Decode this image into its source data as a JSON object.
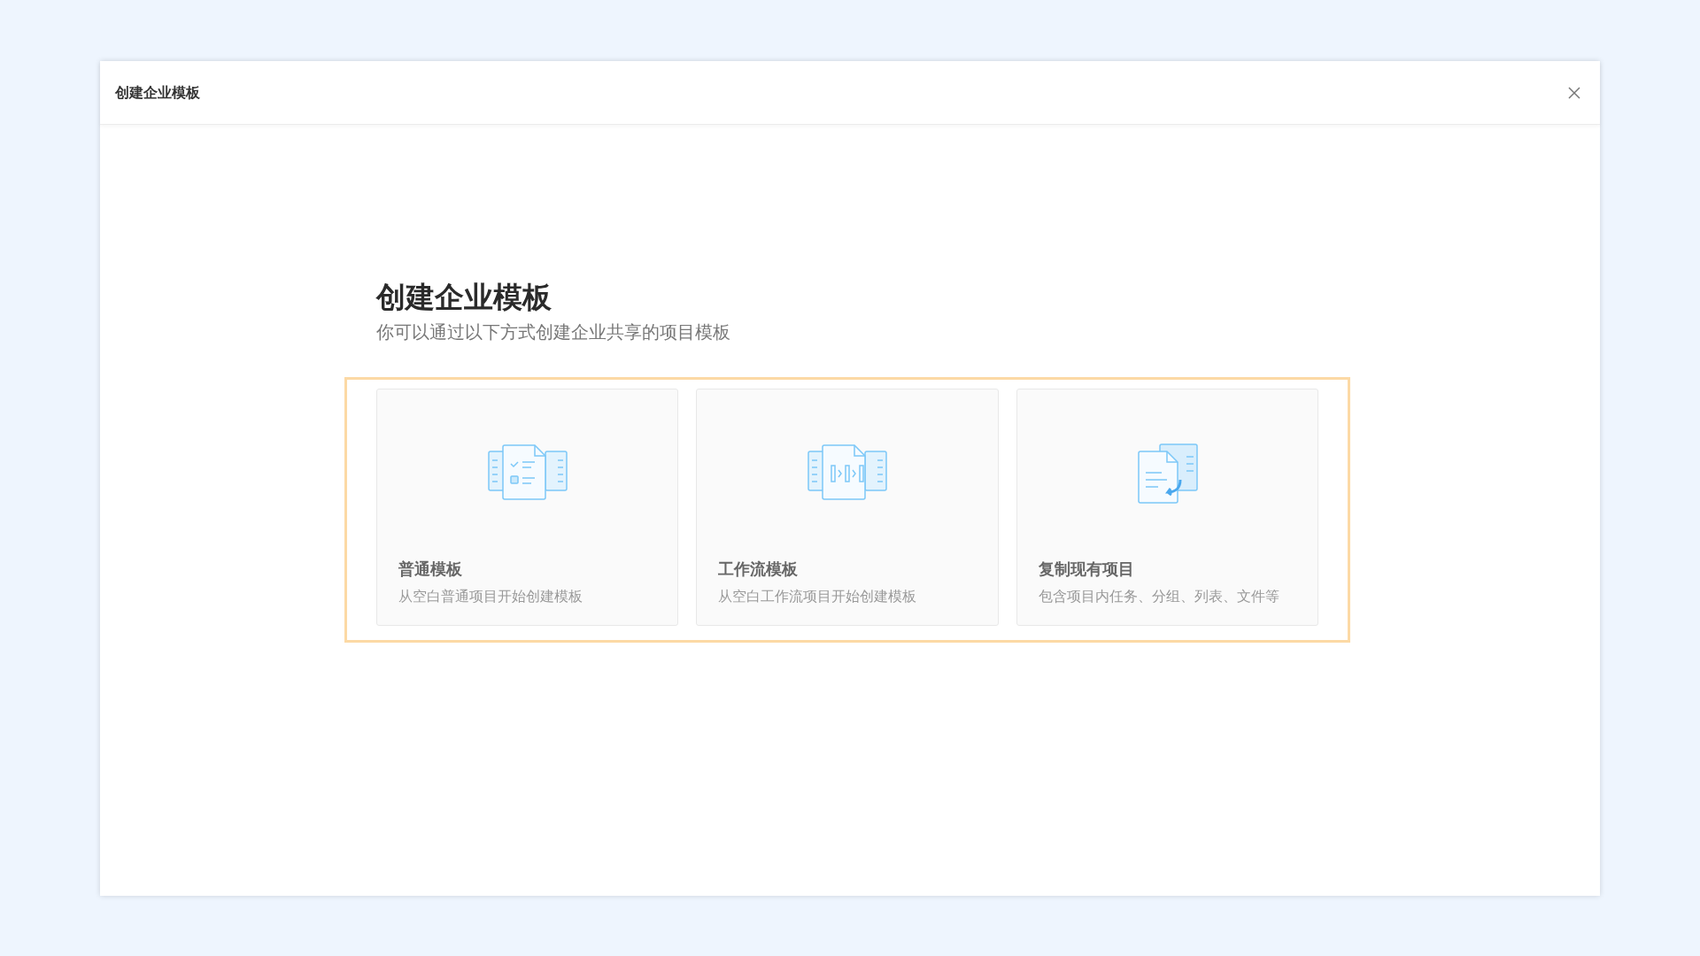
{
  "dialog": {
    "title": "创建企业模板"
  },
  "heading": "创建企业模板",
  "subheading": "你可以通过以下方式创建企业共享的项目模板",
  "options": [
    {
      "kind": "checklist",
      "title": "普通模板",
      "description": "从空白普通项目开始创建模板"
    },
    {
      "kind": "workflow",
      "title": "工作流模板",
      "description": "从空白工作流项目开始创建模板"
    },
    {
      "kind": "copy",
      "title": "复制现有项目",
      "description": "包含项目内任务、分组、列表、文件等"
    }
  ]
}
